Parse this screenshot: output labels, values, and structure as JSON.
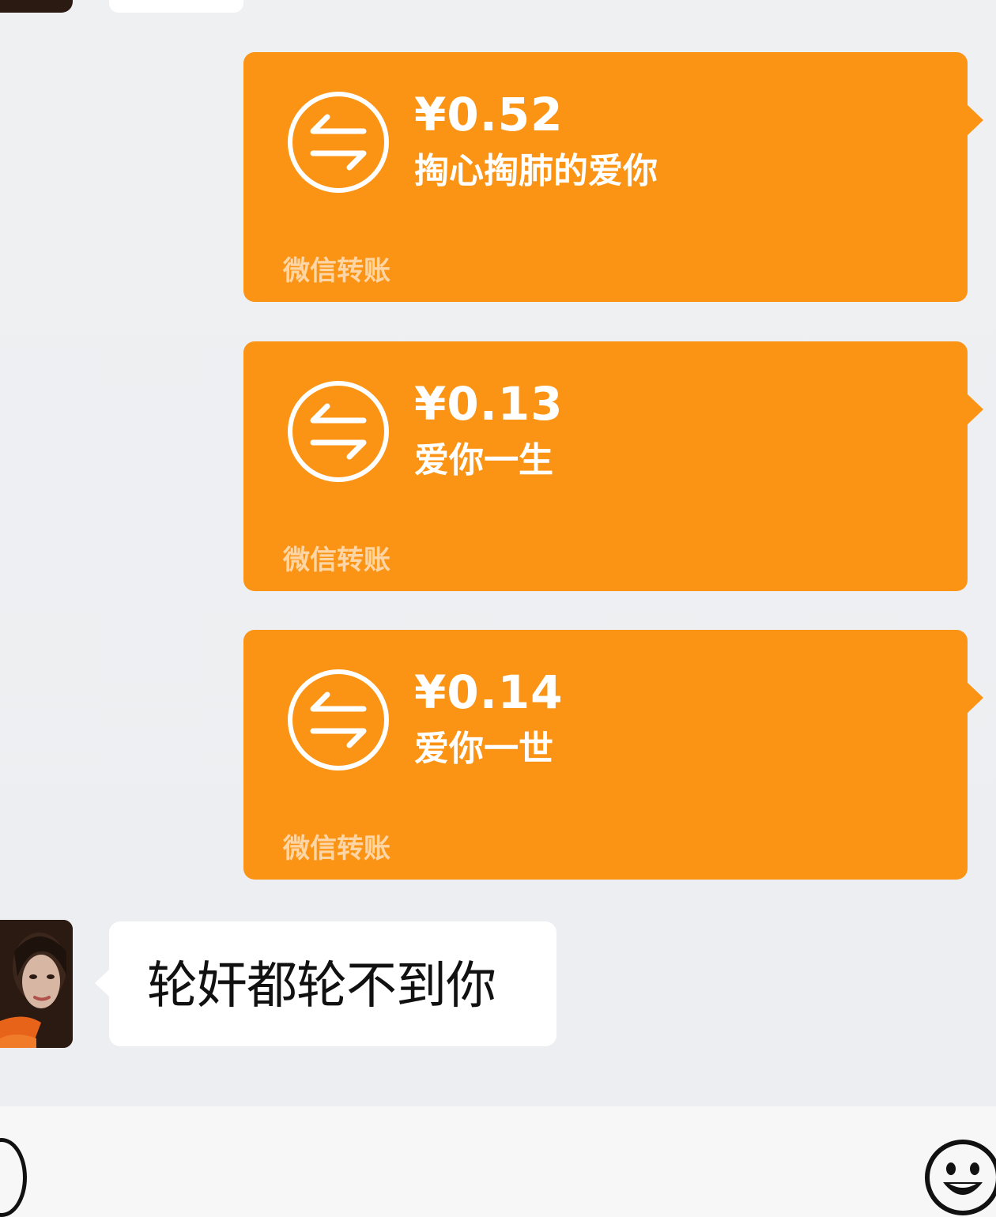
{
  "transfers": [
    {
      "amount": "¥0.52",
      "note": "掏心掏肺的爱你",
      "label": "微信转账"
    },
    {
      "amount": "¥0.13",
      "note": "爱你一生",
      "label": "微信转账"
    },
    {
      "amount": "¥0.14",
      "note": "爱你一世",
      "label": "微信转账"
    }
  ],
  "incoming_message": {
    "text": "轮奸都轮不到你"
  },
  "icons": {
    "transfer": "transfer-arrows-icon",
    "emoji": "smiley-face-icon",
    "voice": "voice-toggle-icon",
    "avatar": "user-avatar"
  },
  "colors": {
    "transfer_card": "#fb9414",
    "chat_background": "#eef0f2",
    "bubble": "#ffffff",
    "text": "#111111"
  }
}
